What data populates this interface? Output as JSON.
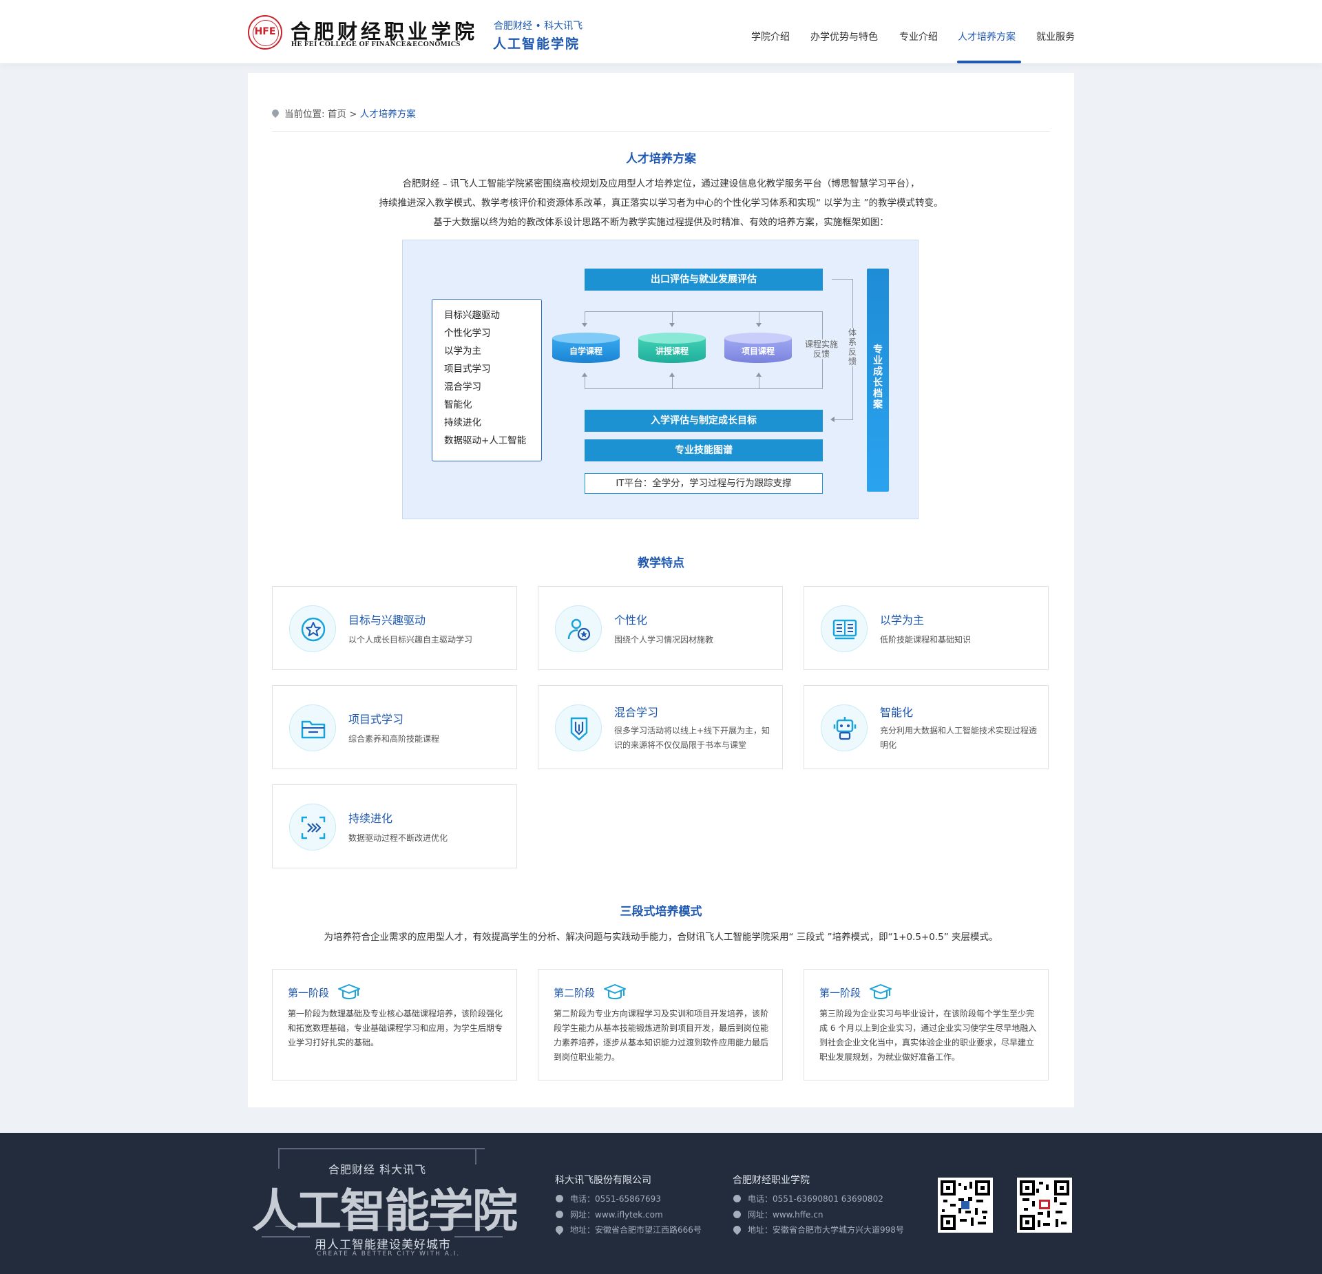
{
  "header": {
    "logo": {
      "seal_text": "HFE",
      "name_cn": "合肥财经职业学院",
      "name_en": "HE FEI COLLEGE OF FINANCE&ECONOMICS",
      "sub1": "合肥财经 • 科大讯飞",
      "sub2": "人工智能学院"
    },
    "nav": [
      {
        "label": "学院介绍",
        "active": false
      },
      {
        "label": "办学优势与特色",
        "active": false
      },
      {
        "label": "专业介绍",
        "active": false
      },
      {
        "label": "人才培养方案",
        "active": true
      },
      {
        "label": "就业服务",
        "active": false
      }
    ]
  },
  "breadcrumb": {
    "prefix": "当前位置:",
    "home": "首页",
    "sep": ">",
    "current": "人才培养方案"
  },
  "plan": {
    "title": "人才培养方案",
    "paragraphs": [
      "合肥财经 – 讯飞人工智能学院紧密围绕高校规划及应用型人才培养定位，通过建设信息化教学服务平台（博思智慧学习平台），",
      "持续推进深入教学模式、教学考核评价和资源体系改革，真正落实以学习者为中心的个性化学习体系和实现“ 以学为主 ”的教学模式转变。",
      "基于大数据以终为始的教改体系设计思路不断为教学实施过程提供及时精准、有效的培养方案，实施框架如图："
    ],
    "diagram": {
      "left_items": [
        "目标兴趣驱动",
        "个性化学习",
        "以学为主",
        "项目式学习",
        "混合学习",
        "智能化",
        "持续进化",
        "数据驱动+人工智能"
      ],
      "top_bar": "出口评估与就业发展评估",
      "courses": [
        "自学课程",
        "讲授课程",
        "项目课程"
      ],
      "course_feedback": "课程实施\n反馈",
      "system_feedback": "体系反馈",
      "bar_entry": "入学评估与制定成长目标",
      "bar_skills": "专业技能图谱",
      "bar_platform": "IT平台：全学分，学习过程与行为跟踪支撑",
      "archive": "专业成长档案"
    }
  },
  "features": {
    "title": "教学特点",
    "items": [
      {
        "icon": "star-circle-icon",
        "title": "目标与兴趣驱动",
        "desc": "以个人成长目标兴趣自主驱动学习"
      },
      {
        "icon": "user-star-icon",
        "title": "个性化",
        "desc": "围绕个人学习情况因材施教"
      },
      {
        "icon": "book-open-icon",
        "title": "以学为主",
        "desc": "低阶技能课程和基础知识"
      },
      {
        "icon": "folder-icon",
        "title": "项目式学习",
        "desc": "综合素养和高阶技能课程"
      },
      {
        "icon": "pencil-shield-icon",
        "title": "混合学习",
        "desc": "很多学习活动将以线上+线下开展为主，知识的来源将不仅仅局限于书本与课堂"
      },
      {
        "icon": "robot-icon",
        "title": "智能化",
        "desc": "充分利用大数据和人工智能技术实现过程透明化"
      },
      {
        "icon": "evolve-arrows-icon",
        "title": "持续进化",
        "desc": "数据驱动过程不断改进优化"
      }
    ]
  },
  "stages": {
    "title": "三段式培养模式",
    "intro": "为培养符合企业需求的应用型人才，有效提高学生的分析、解决问题与实践动手能力，合财讯飞人工智能学院采用“ 三段式 ”培养模式，即“1+0.5+0.5” 夹层模式。",
    "items": [
      {
        "title": "第一阶段",
        "desc": "第一阶段为数理基础及专业核心基础课程培养，该阶段强化和拓宽数理基础，专业基础课程学习和应用，为学生后期专业学习打好扎实的基础。"
      },
      {
        "title": "第二阶段",
        "desc": "第二阶段为专业方向课程学习及实训和项目开发培养，该阶段学生能力从基本技能锻炼进阶到项目开发，最后到岗位能力素养培养，逐步从基本知识能力过渡到软件应用能力最后到岗位职业能力。"
      },
      {
        "title": "第一阶段",
        "desc": "第三阶段为企业实习与毕业设计，在该阶段每个学生至少完成 6 个月以上到企业实习，通过企业实习使学生尽早地融入到社会企业文化当中，真实体验企业的职业要求，尽早建立职业发展规划，为就业做好准备工作。"
      }
    ]
  },
  "footer": {
    "brand": {
      "sub": "合肥财经   科大讯飞",
      "big": "人工智能学院",
      "slogan": "用人工智能建设美好城市",
      "en": "CREATE A BETTER CITY WITH A.I."
    },
    "companies": [
      {
        "name": "科大讯飞股份有限公司",
        "phone": "电话：0551-65867693",
        "web": "网址：www.iflytek.com",
        "address": "地址：安徽省合肥市望江西路666号"
      },
      {
        "name": "合肥财经职业学院",
        "phone": "电话：0551-63690801  63690802",
        "web": "网址：www.hffe.cn",
        "address": "地址：安徽省合肥市大学城方兴大道998号"
      }
    ]
  },
  "colors": {
    "brand_blue": "#1e58b0",
    "bar_blue": "#1d92d2",
    "footer_bg": "#222c3c",
    "seal_red": "#c8232c"
  }
}
